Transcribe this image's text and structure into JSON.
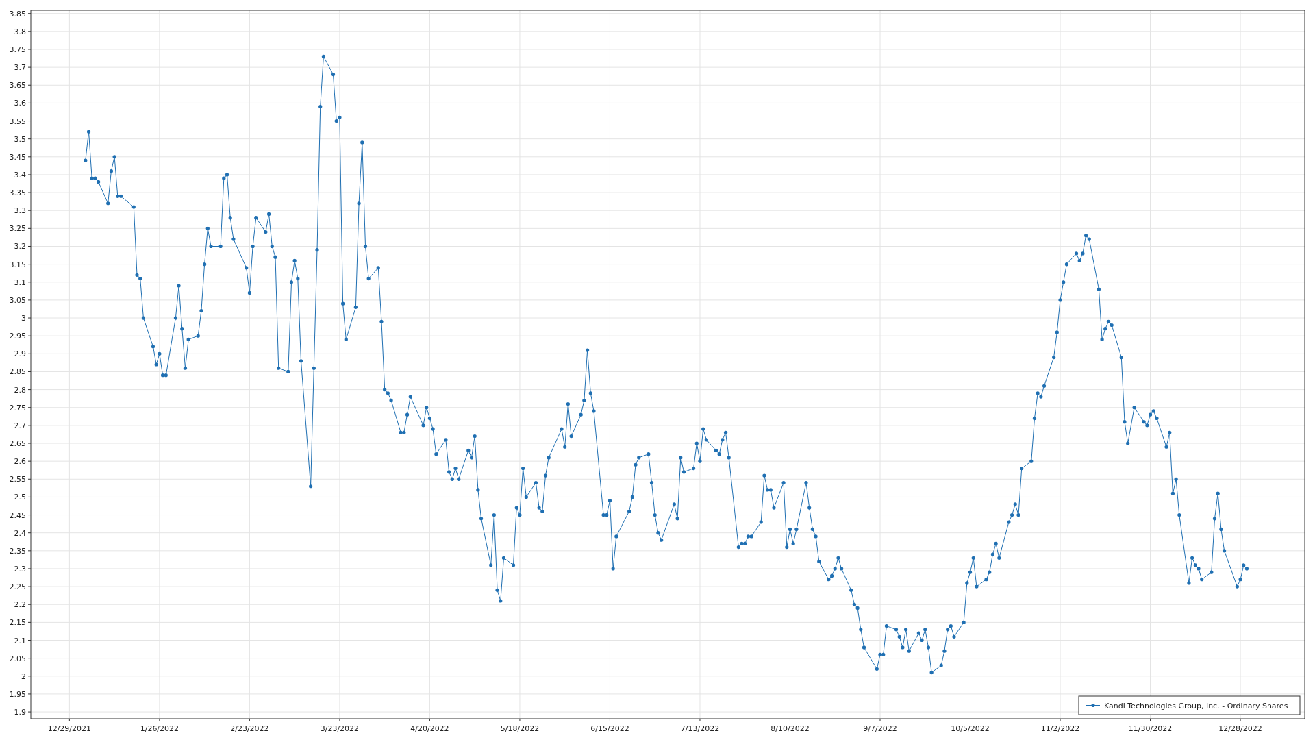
{
  "chart": {
    "chart_data": {
      "type": "line",
      "grid": true,
      "xlim": [
        "2021-12-17",
        "2023-01-17"
      ],
      "ylim": [
        1.881,
        3.859
      ],
      "xticks": [
        {
          "value": "2021-12-29",
          "label": "12/29/2021"
        },
        {
          "value": "2022-01-26",
          "label": "1/26/2022"
        },
        {
          "value": "2022-02-23",
          "label": "2/23/2022"
        },
        {
          "value": "2022-03-23",
          "label": "3/23/2022"
        },
        {
          "value": "2022-04-20",
          "label": "4/20/2022"
        },
        {
          "value": "2022-05-18",
          "label": "5/18/2022"
        },
        {
          "value": "2022-06-15",
          "label": "6/15/2022"
        },
        {
          "value": "2022-07-13",
          "label": "7/13/2022"
        },
        {
          "value": "2022-08-10",
          "label": "8/10/2022"
        },
        {
          "value": "2022-09-07",
          "label": "9/7/2022"
        },
        {
          "value": "2022-10-05",
          "label": "10/5/2022"
        },
        {
          "value": "2022-11-02",
          "label": "11/2/2022"
        },
        {
          "value": "2022-11-30",
          "label": "11/30/2022"
        },
        {
          "value": "2022-12-28",
          "label": "12/28/2022"
        }
      ],
      "yticks": [
        1.9,
        1.95,
        2,
        2.05,
        2.1,
        2.15,
        2.2,
        2.25,
        2.3,
        2.35,
        2.4,
        2.45,
        2.5,
        2.55,
        2.6,
        2.65,
        2.7,
        2.75,
        2.8,
        2.85,
        2.9,
        2.95,
        3,
        3.05,
        3.1,
        3.15,
        3.2,
        3.25,
        3.3,
        3.35,
        3.4,
        3.45,
        3.5,
        3.55,
        3.6,
        3.65,
        3.7,
        3.75,
        3.8,
        3.85
      ],
      "x": [
        "2022-01-03",
        "2022-01-04",
        "2022-01-05",
        "2022-01-06",
        "2022-01-07",
        "2022-01-10",
        "2022-01-11",
        "2022-01-12",
        "2022-01-13",
        "2022-01-14",
        "2022-01-18",
        "2022-01-19",
        "2022-01-20",
        "2022-01-21",
        "2022-01-24",
        "2022-01-25",
        "2022-01-26",
        "2022-01-27",
        "2022-01-28",
        "2022-01-31",
        "2022-02-01",
        "2022-02-02",
        "2022-02-03",
        "2022-02-04",
        "2022-02-07",
        "2022-02-08",
        "2022-02-09",
        "2022-02-10",
        "2022-02-11",
        "2022-02-14",
        "2022-02-15",
        "2022-02-16",
        "2022-02-17",
        "2022-02-18",
        "2022-02-22",
        "2022-02-23",
        "2022-02-24",
        "2022-02-25",
        "2022-02-28",
        "2022-03-01",
        "2022-03-02",
        "2022-03-03",
        "2022-03-04",
        "2022-03-07",
        "2022-03-08",
        "2022-03-09",
        "2022-03-10",
        "2022-03-11",
        "2022-03-14",
        "2022-03-15",
        "2022-03-16",
        "2022-03-17",
        "2022-03-18",
        "2022-03-21",
        "2022-03-22",
        "2022-03-23",
        "2022-03-24",
        "2022-03-25",
        "2022-03-28",
        "2022-03-29",
        "2022-03-30",
        "2022-03-31",
        "2022-04-01",
        "2022-04-04",
        "2022-04-05",
        "2022-04-06",
        "2022-04-07",
        "2022-04-08",
        "2022-04-11",
        "2022-04-12",
        "2022-04-13",
        "2022-04-14",
        "2022-04-18",
        "2022-04-19",
        "2022-04-20",
        "2022-04-21",
        "2022-04-22",
        "2022-04-25",
        "2022-04-26",
        "2022-04-27",
        "2022-04-28",
        "2022-04-29",
        "2022-05-02",
        "2022-05-03",
        "2022-05-04",
        "2022-05-05",
        "2022-05-06",
        "2022-05-09",
        "2022-05-10",
        "2022-05-11",
        "2022-05-12",
        "2022-05-13",
        "2022-05-16",
        "2022-05-17",
        "2022-05-18",
        "2022-05-19",
        "2022-05-20",
        "2022-05-23",
        "2022-05-24",
        "2022-05-25",
        "2022-05-26",
        "2022-05-27",
        "2022-05-31",
        "2022-06-01",
        "2022-06-02",
        "2022-06-03",
        "2022-06-06",
        "2022-06-07",
        "2022-06-08",
        "2022-06-09",
        "2022-06-10",
        "2022-06-13",
        "2022-06-14",
        "2022-06-15",
        "2022-06-16",
        "2022-06-17",
        "2022-06-21",
        "2022-06-22",
        "2022-06-23",
        "2022-06-24",
        "2022-06-27",
        "2022-06-28",
        "2022-06-29",
        "2022-06-30",
        "2022-07-01",
        "2022-07-05",
        "2022-07-06",
        "2022-07-07",
        "2022-07-08",
        "2022-07-11",
        "2022-07-12",
        "2022-07-13",
        "2022-07-14",
        "2022-07-15",
        "2022-07-18",
        "2022-07-19",
        "2022-07-20",
        "2022-07-21",
        "2022-07-22",
        "2022-07-25",
        "2022-07-26",
        "2022-07-27",
        "2022-07-28",
        "2022-07-29",
        "2022-08-01",
        "2022-08-02",
        "2022-08-03",
        "2022-08-04",
        "2022-08-05",
        "2022-08-08",
        "2022-08-09",
        "2022-08-10",
        "2022-08-11",
        "2022-08-12",
        "2022-08-15",
        "2022-08-16",
        "2022-08-17",
        "2022-08-18",
        "2022-08-19",
        "2022-08-22",
        "2022-08-23",
        "2022-08-24",
        "2022-08-25",
        "2022-08-26",
        "2022-08-29",
        "2022-08-30",
        "2022-08-31",
        "2022-09-01",
        "2022-09-02",
        "2022-09-06",
        "2022-09-07",
        "2022-09-08",
        "2022-09-09",
        "2022-09-12",
        "2022-09-13",
        "2022-09-14",
        "2022-09-15",
        "2022-09-16",
        "2022-09-19",
        "2022-09-20",
        "2022-09-21",
        "2022-09-22",
        "2022-09-23",
        "2022-09-26",
        "2022-09-27",
        "2022-09-28",
        "2022-09-29",
        "2022-09-30",
        "2022-10-03",
        "2022-10-04",
        "2022-10-05",
        "2022-10-06",
        "2022-10-07",
        "2022-10-10",
        "2022-10-11",
        "2022-10-12",
        "2022-10-13",
        "2022-10-14",
        "2022-10-17",
        "2022-10-18",
        "2022-10-19",
        "2022-10-20",
        "2022-10-21",
        "2022-10-24",
        "2022-10-25",
        "2022-10-26",
        "2022-10-27",
        "2022-10-28",
        "2022-10-31",
        "2022-11-01",
        "2022-11-02",
        "2022-11-03",
        "2022-11-04",
        "2022-11-07",
        "2022-11-08",
        "2022-11-09",
        "2022-11-10",
        "2022-11-11",
        "2022-11-14",
        "2022-11-15",
        "2022-11-16",
        "2022-11-17",
        "2022-11-18",
        "2022-11-21",
        "2022-11-22",
        "2022-11-23",
        "2022-11-25",
        "2022-11-28",
        "2022-11-29",
        "2022-11-30",
        "2022-12-01",
        "2022-12-02",
        "2022-12-05",
        "2022-12-06",
        "2022-12-07",
        "2022-12-08",
        "2022-12-09",
        "2022-12-12",
        "2022-12-13",
        "2022-12-14",
        "2022-12-15",
        "2022-12-16",
        "2022-12-19",
        "2022-12-20",
        "2022-12-21",
        "2022-12-22",
        "2022-12-23",
        "2022-12-27",
        "2022-12-28",
        "2022-12-29",
        "2022-12-30"
      ],
      "series": [
        {
          "name": "Kandi Technologies Group, Inc. - Ordinary Shares",
          "color": "#1f6fb2",
          "values": [
            3.44,
            3.52,
            3.39,
            3.39,
            3.38,
            3.32,
            3.41,
            3.45,
            3.34,
            3.34,
            3.31,
            3.12,
            3.11,
            3.0,
            2.92,
            2.87,
            2.9,
            2.84,
            2.84,
            3.0,
            3.09,
            2.97,
            2.86,
            2.94,
            2.95,
            3.02,
            3.15,
            3.25,
            3.2,
            3.2,
            3.39,
            3.4,
            3.28,
            3.22,
            3.14,
            3.07,
            3.2,
            3.28,
            3.24,
            3.29,
            3.2,
            3.17,
            2.86,
            2.85,
            3.1,
            3.16,
            3.11,
            2.88,
            2.53,
            2.86,
            3.19,
            3.59,
            3.73,
            3.68,
            3.55,
            3.56,
            3.04,
            2.94,
            3.03,
            3.32,
            3.49,
            3.2,
            3.11,
            3.14,
            2.99,
            2.8,
            2.79,
            2.77,
            2.68,
            2.68,
            2.73,
            2.78,
            2.7,
            2.75,
            2.72,
            2.69,
            2.62,
            2.66,
            2.57,
            2.55,
            2.58,
            2.55,
            2.63,
            2.61,
            2.67,
            2.52,
            2.44,
            2.31,
            2.45,
            2.24,
            2.21,
            2.33,
            2.31,
            2.47,
            2.45,
            2.58,
            2.5,
            2.54,
            2.47,
            2.46,
            2.56,
            2.61,
            2.69,
            2.64,
            2.76,
            2.67,
            2.73,
            2.77,
            2.91,
            2.79,
            2.74,
            2.45,
            2.45,
            2.49,
            2.3,
            2.39,
            2.46,
            2.5,
            2.59,
            2.61,
            2.62,
            2.54,
            2.45,
            2.4,
            2.38,
            2.48,
            2.44,
            2.61,
            2.57,
            2.58,
            2.65,
            2.6,
            2.69,
            2.66,
            2.63,
            2.62,
            2.66,
            2.68,
            2.61,
            2.36,
            2.37,
            2.37,
            2.39,
            2.39,
            2.43,
            2.56,
            2.52,
            2.52,
            2.47,
            2.54,
            2.36,
            2.41,
            2.37,
            2.41,
            2.54,
            2.47,
            2.41,
            2.39,
            2.32,
            2.27,
            2.28,
            2.3,
            2.33,
            2.3,
            2.24,
            2.2,
            2.19,
            2.13,
            2.08,
            2.02,
            2.06,
            2.06,
            2.14,
            2.13,
            2.11,
            2.08,
            2.13,
            2.07,
            2.12,
            2.1,
            2.13,
            2.08,
            2.01,
            2.03,
            2.07,
            2.13,
            2.14,
            2.11,
            2.15,
            2.26,
            2.29,
            2.33,
            2.25,
            2.27,
            2.29,
            2.34,
            2.37,
            2.33,
            2.43,
            2.45,
            2.48,
            2.45,
            2.58,
            2.6,
            2.72,
            2.79,
            2.78,
            2.81,
            2.89,
            2.96,
            3.05,
            3.1,
            3.15,
            3.18,
            3.16,
            3.18,
            3.23,
            3.22,
            3.08,
            2.94,
            2.97,
            2.99,
            2.98,
            2.89,
            2.71,
            2.65,
            2.75,
            2.71,
            2.7,
            2.73,
            2.74,
            2.72,
            2.64,
            2.68,
            2.51,
            2.55,
            2.45,
            2.26,
            2.33,
            2.31,
            2.3,
            2.27,
            2.29,
            2.44,
            2.51,
            2.41,
            2.35,
            2.25,
            2.27,
            2.31,
            2.3
          ]
        }
      ]
    }
  }
}
